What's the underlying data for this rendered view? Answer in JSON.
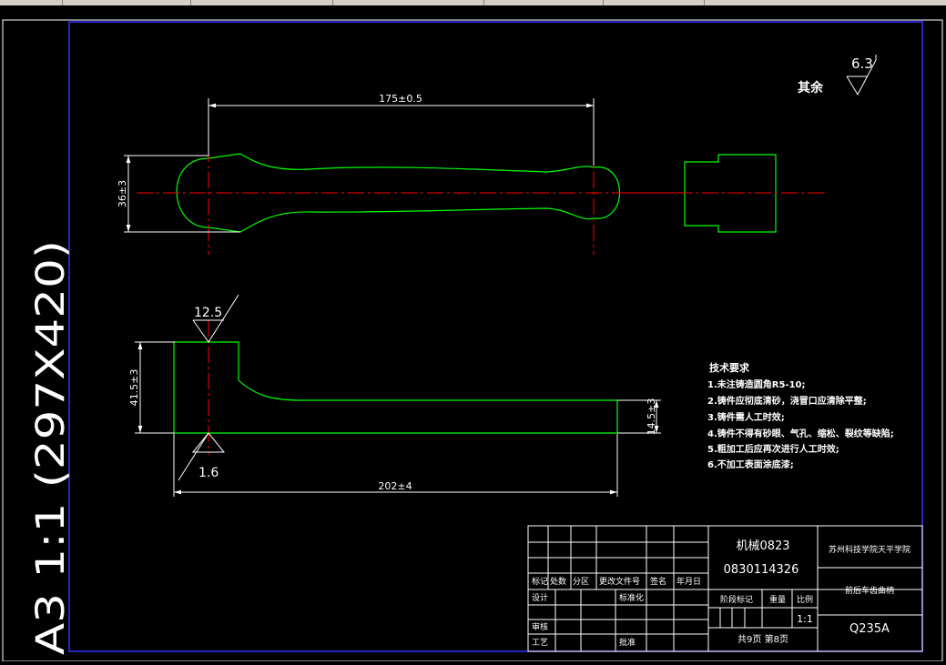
{
  "sheet_label": "A3 1:1 (297X420)",
  "roughness_other": {
    "label": "其余",
    "value": "6.3"
  },
  "top_view": {
    "dim_length": "175±0.5",
    "dim_height": "36±3"
  },
  "front_view": {
    "roughness_top": "12.5",
    "roughness_bottom": "1.6",
    "dim_height_left": "41.5±3",
    "dim_height_right": "14.5±3",
    "dim_length": "202±4"
  },
  "tech_requirements": {
    "title": "技术要求",
    "items": [
      "1.未注铸造圆角R5-10;",
      "2.铸件应彻底清砂，浇冒口应清除平整;",
      "3.铸件需人工时效;",
      "4.铸件不得有砂眼、气孔、缩松、裂纹等缺陷;",
      "5.粗加工后应再次进行人工时效;",
      "6.不加工表面涂底漆;"
    ]
  },
  "title_block": {
    "class_code": "机械0823",
    "student_id": "0830114326",
    "school": "苏州科技学院天平学院",
    "part_name": "前后车齿曲柄",
    "material": "Q235A",
    "sheet_info": "共9页 第8页",
    "scale": "1:1",
    "h_mark": "标记",
    "h_count": "处数",
    "h_zone": "分区",
    "h_docno": "更改文件号",
    "h_sign": "签名",
    "h_date": "年月日",
    "r_design": "设计",
    "r_std": "标准化",
    "r_review": "审核",
    "r_process": "工艺",
    "r_approve": "批准",
    "r_stage": "阶段标记",
    "r_weight": "重量",
    "r_ratio": "比例"
  }
}
